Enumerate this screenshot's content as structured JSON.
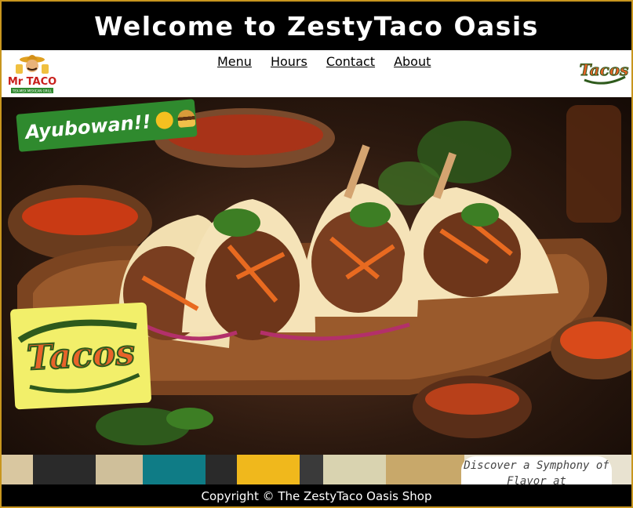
{
  "header": {
    "title": "Welcome to ZestyTaco Oasis"
  },
  "nav": {
    "items": [
      {
        "label": "Menu"
      },
      {
        "label": "Hours"
      },
      {
        "label": "Contact"
      },
      {
        "label": "About"
      }
    ]
  },
  "logos": {
    "left": {
      "icon": "mr-taco-logo-icon",
      "text": "Mr TACO",
      "subtext": "TEX-MEX MEXICAN GRILL"
    },
    "right": {
      "icon": "tacos-logo-icon",
      "text": "Tacos"
    }
  },
  "hero": {
    "image_icon": "tacos-photo",
    "greeting": "Ayubowan!!",
    "greeting_emojis": [
      "smiling-face-icon",
      "burger-icon"
    ],
    "badge_text": "Tacos"
  },
  "promo": {
    "text": "Discover a Symphony of Flavor at"
  },
  "footer": {
    "copyright": "Copyright © The ZestyTaco Oasis Shop"
  },
  "colors": {
    "frame_border": "#c8961e",
    "greeting_bg": "#2f8a2e",
    "badge_bg": "#f2ef6a",
    "tacos_orange": "#e8632a"
  }
}
